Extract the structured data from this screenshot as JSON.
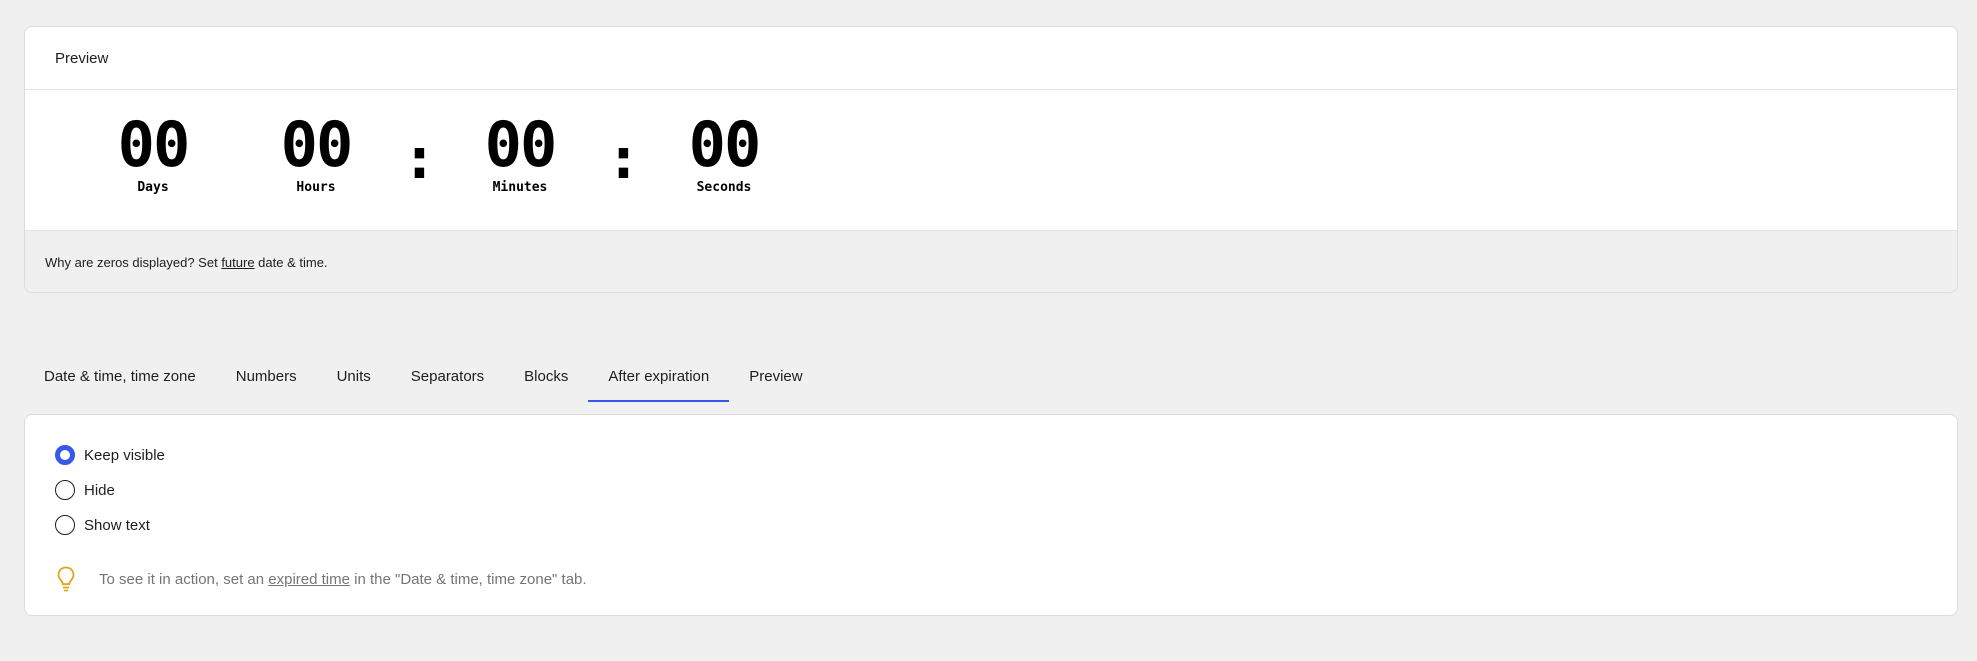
{
  "preview": {
    "title": "Preview",
    "blocks": [
      {
        "value": "00",
        "unit": "Days"
      },
      {
        "value": "00",
        "unit": "Hours"
      },
      {
        "value": "00",
        "unit": "Minutes"
      },
      {
        "value": "00",
        "unit": "Seconds"
      }
    ],
    "separator": ":",
    "note": {
      "prefix": "Why are zeros displayed? Set ",
      "link": "future",
      "suffix": " date & time."
    }
  },
  "tabs": [
    {
      "label": "Date & time, time zone",
      "active": false
    },
    {
      "label": "Numbers",
      "active": false
    },
    {
      "label": "Units",
      "active": false
    },
    {
      "label": "Separators",
      "active": false
    },
    {
      "label": "Blocks",
      "active": false
    },
    {
      "label": "After expiration",
      "active": true
    },
    {
      "label": "Preview",
      "active": false
    }
  ],
  "after_expiration": {
    "options": [
      {
        "label": "Keep visible",
        "checked": true
      },
      {
        "label": "Hide",
        "checked": false
      },
      {
        "label": "Show text",
        "checked": false
      }
    ],
    "tip": {
      "icon": "lightbulb-icon",
      "prefix": "To see it in action, set an ",
      "link": "expired time",
      "suffix": " in the \"Date & time, time zone\" tab."
    }
  },
  "colors": {
    "accent": "#3858e9",
    "tip_icon": "#dba617",
    "background": "#f0f0f0"
  }
}
